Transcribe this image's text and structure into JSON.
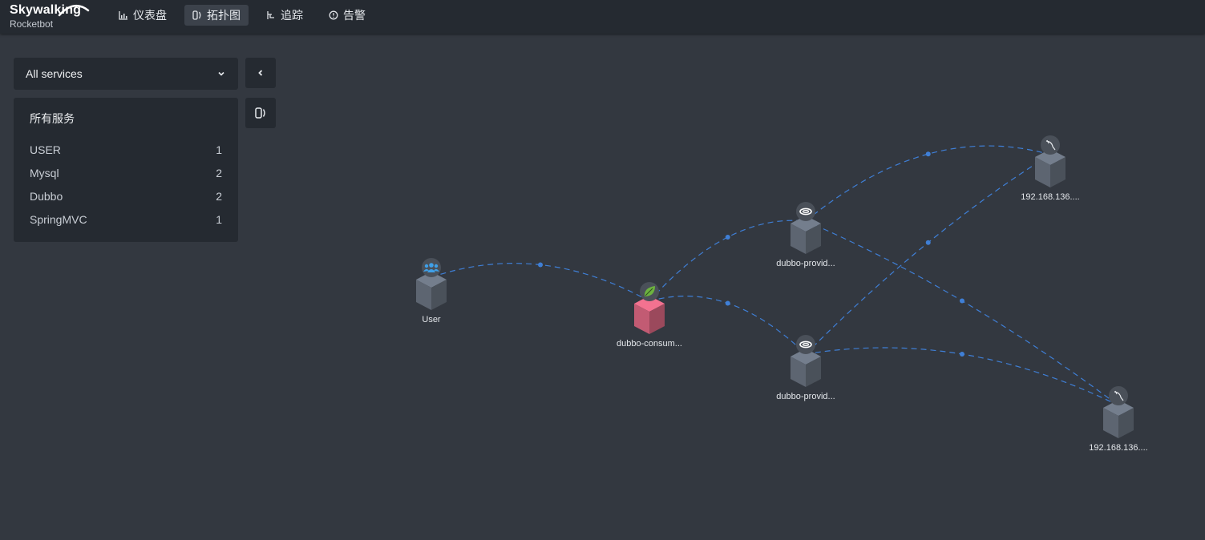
{
  "app": {
    "logo": "Skywalking",
    "subtitle": "Rocketbot"
  },
  "nav": [
    {
      "label": "仪表盘",
      "icon": "chart-icon",
      "active": false
    },
    {
      "label": "拓扑图",
      "icon": "topology-icon",
      "active": true
    },
    {
      "label": "追踪",
      "icon": "trace-icon",
      "active": false
    },
    {
      "label": "告警",
      "icon": "alarm-icon",
      "active": false
    }
  ],
  "service_select": {
    "value": "All services"
  },
  "services_panel": {
    "title": "所有服务",
    "items": [
      {
        "name": "USER",
        "count": "1"
      },
      {
        "name": "Mysql",
        "count": "2"
      },
      {
        "name": "Dubbo",
        "count": "2"
      },
      {
        "name": "SpringMVC",
        "count": "1"
      }
    ]
  },
  "topology": {
    "nodes": [
      {
        "id": "user",
        "label": "User",
        "icon": "users-icon"
      },
      {
        "id": "consumer",
        "label": "dubbo-consum...",
        "icon": "spring-icon"
      },
      {
        "id": "provider1",
        "label": "dubbo-provid...",
        "icon": "dubbo-icon"
      },
      {
        "id": "provider2",
        "label": "dubbo-provid...",
        "icon": "dubbo-icon"
      },
      {
        "id": "mysql1",
        "label": "192.168.136....",
        "icon": "mysql-icon"
      },
      {
        "id": "mysql2",
        "label": "192.168.136....",
        "icon": "mysql-icon"
      }
    ],
    "edges": [
      {
        "from": "user",
        "to": "consumer"
      },
      {
        "from": "consumer",
        "to": "provider1"
      },
      {
        "from": "consumer",
        "to": "provider2"
      },
      {
        "from": "provider1",
        "to": "mysql1"
      },
      {
        "from": "provider1",
        "to": "mysql2"
      },
      {
        "from": "provider2",
        "to": "mysql1"
      },
      {
        "from": "provider2",
        "to": "mysql2"
      }
    ],
    "colors": {
      "edge": "#3f7fd6",
      "service_cube": "#5d6571",
      "consumer_cube": "#c25b73"
    }
  }
}
